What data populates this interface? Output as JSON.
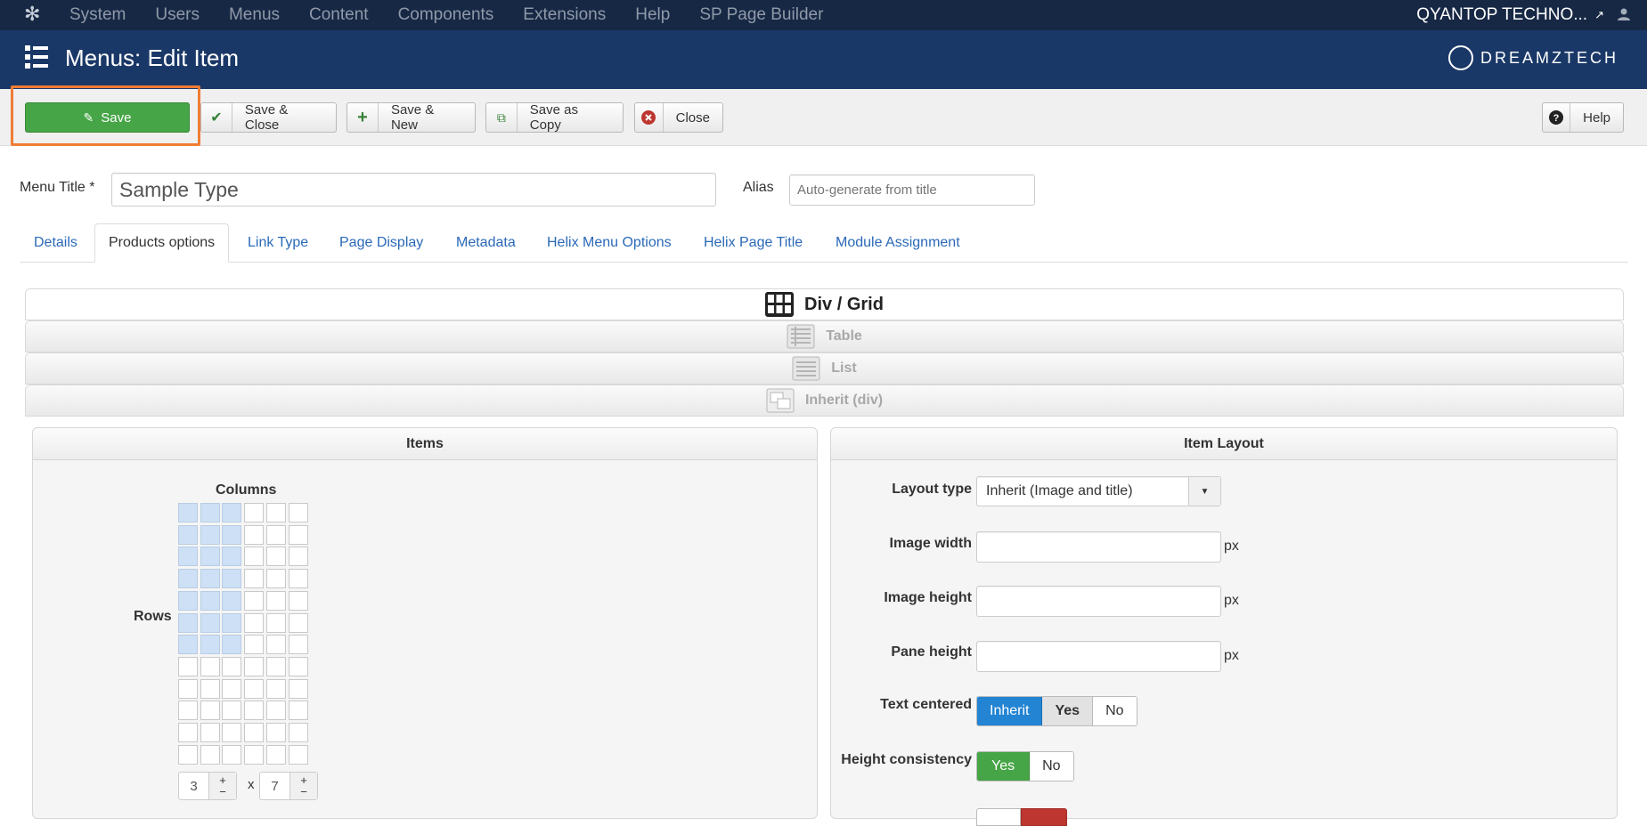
{
  "topbar": {
    "menu": [
      "System",
      "Users",
      "Menus",
      "Content",
      "Components",
      "Extensions",
      "Help",
      "SP Page Builder"
    ],
    "site_name": "QYANTOP TECHNO..."
  },
  "header": {
    "title": "Menus: Edit Item",
    "brand": "DREAMZTECH"
  },
  "toolbar": {
    "save": "Save",
    "save_close": "Save & Close",
    "save_new": "Save & New",
    "save_copy": "Save as Copy",
    "close": "Close",
    "help": "Help"
  },
  "form": {
    "menu_title_label": "Menu Title *",
    "menu_title_value": "Sample Type",
    "alias_label": "Alias",
    "alias_placeholder": "Auto-generate from title"
  },
  "tabs": [
    "Details",
    "Products options",
    "Link Type",
    "Page Display",
    "Metadata",
    "Helix Menu Options",
    "Helix Page Title",
    "Module Assignment"
  ],
  "accordion": {
    "div_grid": "Div / Grid",
    "table": "Table",
    "list": "List",
    "inherit": "Inherit (div)"
  },
  "items_panel": {
    "title": "Items",
    "columns_label": "Columns",
    "rows_label": "Rows",
    "columns_value": "3",
    "times": "x",
    "rows_value": "7"
  },
  "layout_panel": {
    "title": "Item Layout",
    "layout_type_label": "Layout type",
    "layout_type_value": "Inherit (Image and title)",
    "image_width_label": "Image width",
    "image_height_label": "Image height",
    "pane_height_label": "Pane height",
    "unit": "px",
    "text_centered_label": "Text centered",
    "text_centered_options": [
      "Inherit",
      "Yes",
      "No"
    ],
    "height_consistency_label": "Height consistency",
    "height_consistency_options": [
      "Yes",
      "No"
    ]
  },
  "colors": {
    "topbar": "#172845",
    "header": "#1a3867",
    "save_green": "#46a546",
    "highlight": "#f07d35",
    "active_blue": "#2384d3"
  }
}
